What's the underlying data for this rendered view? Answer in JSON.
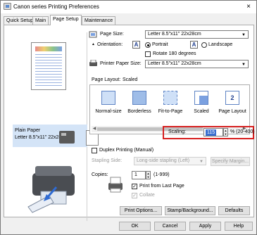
{
  "window": {
    "title": "Canon series Printing Preferences",
    "close_glyph": "×",
    "icon": "printer-app-icon"
  },
  "tabs": [
    {
      "label": "Quick Setup"
    },
    {
      "label": "Main"
    },
    {
      "label": "Page Setup"
    },
    {
      "label": "Maintenance"
    }
  ],
  "preview": {
    "paper_caption_line1": "Plain Paper",
    "paper_caption_line2": "Letter 8.5\"x11\" 22x28cm"
  },
  "page_size": {
    "label": "Page Size:",
    "value": "Letter 8.5\"x11\" 22x28cm"
  },
  "orientation": {
    "label": "Orientation:",
    "portrait_label": "Portrait",
    "landscape_label": "Landscape",
    "portrait_icon_letter": "A",
    "landscape_icon_letter": "A",
    "selected": "Portrait",
    "rotate_label": "Rotate 180 degrees"
  },
  "printer_paper_size": {
    "label": "Printer Paper Size:",
    "value": "Letter 8.5\"x11\" 22x28cm"
  },
  "page_layout": {
    "label": "Page Layout:",
    "current": "Scaled",
    "items": [
      {
        "label": "Normal-size"
      },
      {
        "label": "Borderless"
      },
      {
        "label": "Fit-to-Page"
      },
      {
        "label": "Scaled"
      },
      {
        "label": "Page Layout"
      }
    ],
    "page_layout_icon_number": "2"
  },
  "scaling": {
    "label": "Scaling:",
    "value": "115",
    "range": "% (20-400)"
  },
  "duplex": {
    "label": "Duplex Printing (Manual)",
    "stapling_label": "Stapling Side:",
    "stapling_value": "Long-side stapling (Left)",
    "specify_margin": "Specify Margin..."
  },
  "copies": {
    "label": "Copies:",
    "value": "1",
    "range": "(1-999)",
    "print_from_last_label": "Print from Last Page",
    "collate_label": "Collate",
    "check_glyph": "✓"
  },
  "bottom_buttons": {
    "print_options": "Print Options...",
    "stamp_background": "Stamp/Background...",
    "defaults": "Defaults"
  },
  "dialog_buttons": {
    "ok": "OK",
    "cancel": "Cancel",
    "apply": "Apply",
    "help": "Help"
  },
  "colors": {
    "highlight": "#d61f1f",
    "selection": "#3a6fd0",
    "caption_bg": "#d4e4f7"
  }
}
